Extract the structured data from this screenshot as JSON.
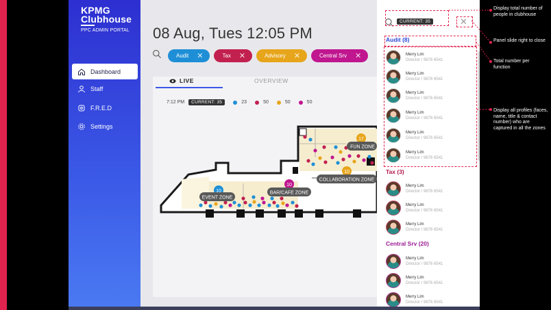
{
  "brand": {
    "line1": "KPMG",
    "line2": "Clubhouse",
    "portal": "PPC ADMIN PORTAL"
  },
  "nav": [
    {
      "label": "Dashboard",
      "icon": "home-icon",
      "active": true
    },
    {
      "label": "Staff",
      "icon": "staff-icon",
      "active": false
    },
    {
      "label": "F.R.E.D",
      "icon": "fred-icon",
      "active": false
    },
    {
      "label": "Settings",
      "icon": "gear-icon",
      "active": false
    }
  ],
  "header": {
    "date": "08 Aug, Tues 12:05  PM"
  },
  "filters": [
    {
      "label": "Audit",
      "color": "#1e8fd6"
    },
    {
      "label": "Tax",
      "color": "#c2204f"
    },
    {
      "label": "Advisory",
      "color": "#e7a51b"
    },
    {
      "label": "Central Srv",
      "color": "#c0168f"
    }
  ],
  "tabs": {
    "live": "LIVE",
    "overview": "OVERVIEW"
  },
  "stats": {
    "time": "7:12 PM",
    "current": "CURRENT: 35",
    "items": [
      {
        "value": "23",
        "color": "#1e8fd6"
      },
      {
        "value": "50",
        "color": "#c2204f"
      },
      {
        "value": "50",
        "color": "#e7a51b"
      },
      {
        "value": "50",
        "color": "#c0168f"
      }
    ]
  },
  "zones": {
    "event": {
      "label": "EVENT ZONE",
      "count": "10"
    },
    "bar": {
      "label": "BAR/CAFE ZONE",
      "count": "10"
    },
    "fun": {
      "label": "FUN ZONE",
      "count": "17"
    },
    "collab": {
      "label": "COLLABORATION ZONE",
      "count": "10"
    }
  },
  "panel": {
    "current": "CURRENT: 35",
    "groups": [
      {
        "title": "Audit  (8)",
        "kind": "audit"
      },
      {
        "title": "Tax (3)",
        "kind": "tax"
      },
      {
        "title": "Central Srv  (20)",
        "kind": "csrv"
      }
    ],
    "profile": {
      "name": "Merry Lim",
      "title": "Director  /  9876 6541"
    }
  },
  "annotations": {
    "total": "Display total number of people in clubhouse",
    "close": "Panel slide right to close",
    "perfunction": "Total number per function",
    "profiles": "Display all profiles (faces, name, title & contact number) who are captured in all the zones"
  }
}
